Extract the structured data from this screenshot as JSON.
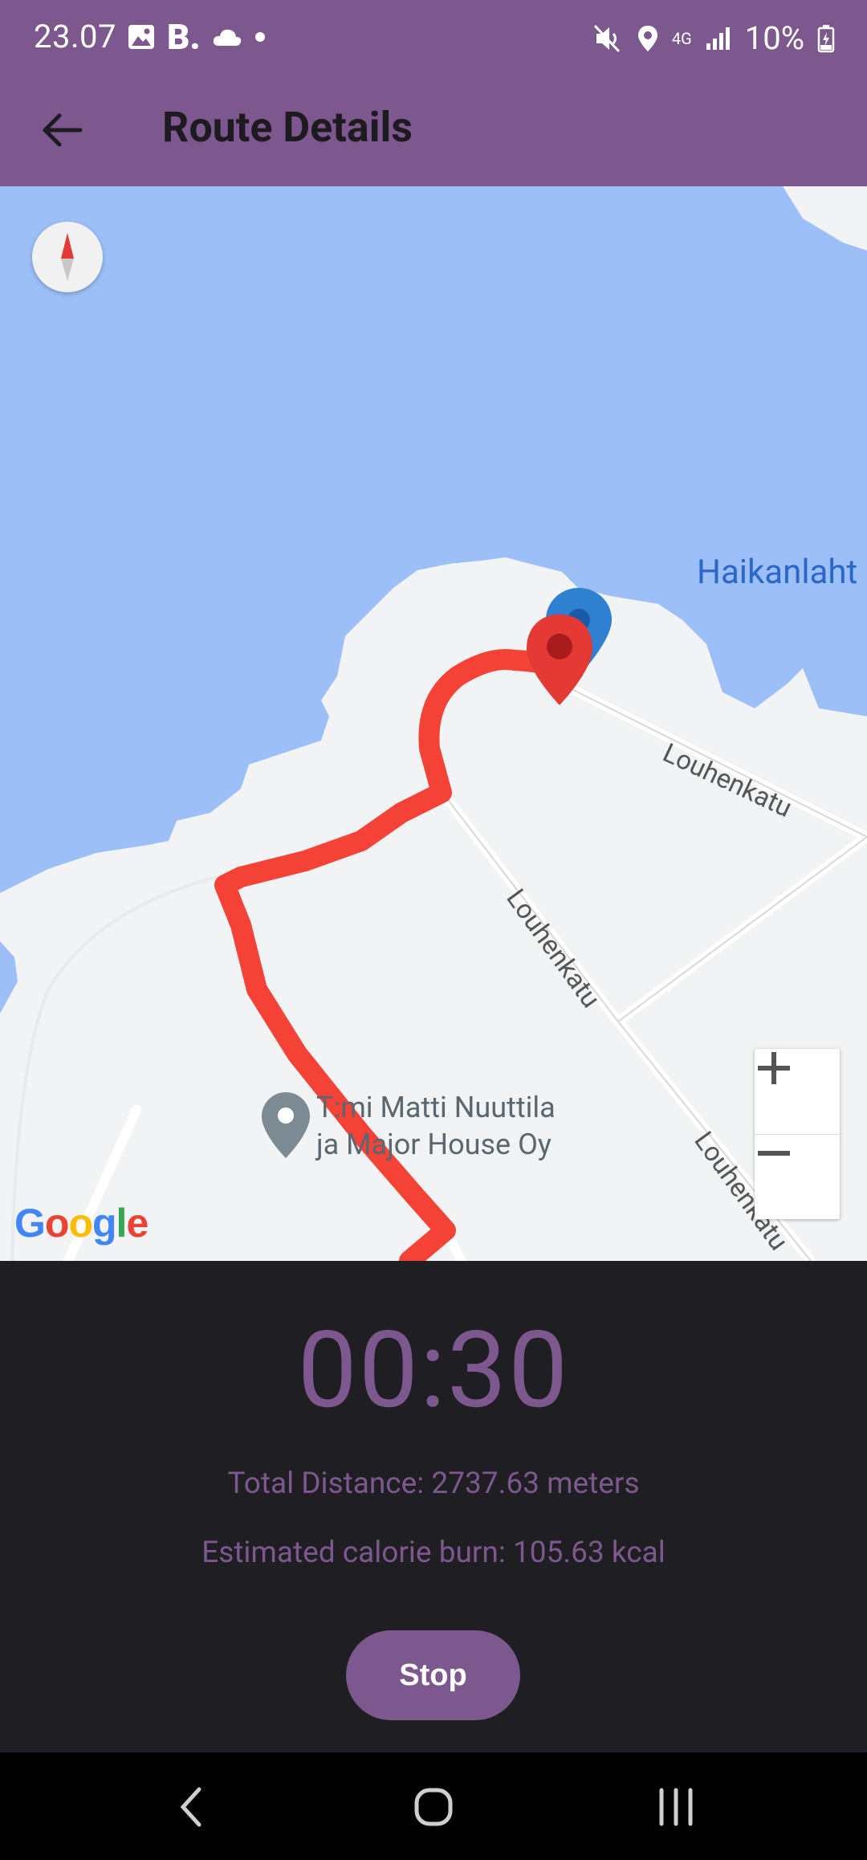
{
  "status_bar": {
    "time": "23.07",
    "battery_percent": "10%",
    "network": "4G",
    "icons": [
      "gallery-icon",
      "booking-b-icon",
      "cloud-icon",
      "dot-icon",
      "mute-icon",
      "location-icon",
      "signal-icon",
      "battery-charging-icon"
    ]
  },
  "app_bar": {
    "title": "Route Details",
    "back_icon": "arrow-back-icon"
  },
  "map": {
    "water_label": "Haikanlaht",
    "streets": [
      "Louhenkatu",
      "Louhenkatu",
      "Louhenkatu"
    ],
    "poi": {
      "line1": "T:mi Matti Nuuttila",
      "line2": "ja Major House Oy"
    },
    "attribution": "Google",
    "zoom_in_label": "+",
    "zoom_out_label": "−",
    "colors": {
      "water": "#9dbff7",
      "land": "#f1f3f4",
      "route": "#f44336",
      "marker": "#e53935",
      "location_dot": "#2f80d1"
    }
  },
  "tracking": {
    "timer": "00:30",
    "distance_text": "Total Distance: 2737.63 meters",
    "calorie_text": "Estimated calorie burn: 105.63 kcal",
    "stop_label": "Stop"
  },
  "theme": {
    "accent": "#7c588f",
    "panel_bg": "#1f1e22"
  },
  "nav_bar": {
    "buttons": [
      "back-nav-icon",
      "home-nav-icon",
      "recents-nav-icon"
    ]
  }
}
